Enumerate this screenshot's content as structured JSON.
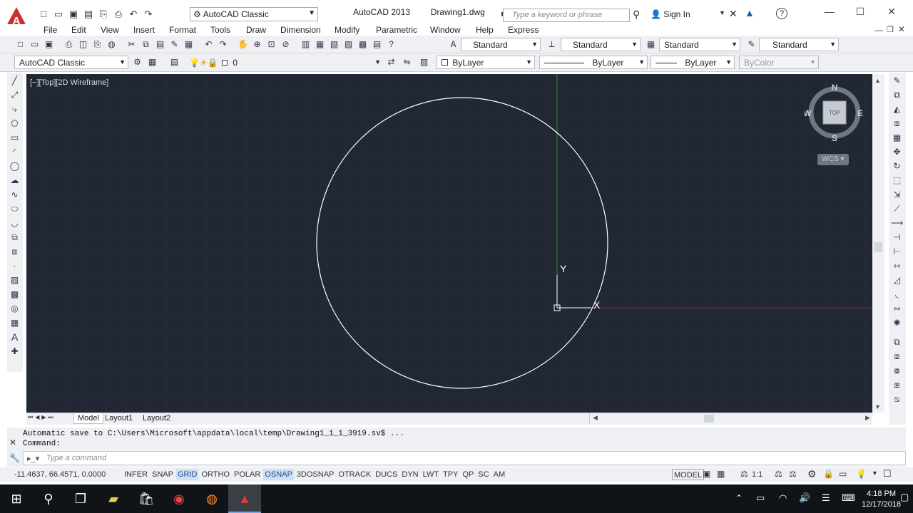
{
  "app": {
    "title": "AutoCAD 2013",
    "document": "Drawing1.dwg",
    "workspace": "AutoCAD Classic",
    "search_placeholder": "Type a keyword or phrase",
    "sign_in": "Sign In",
    "help": "?"
  },
  "menu": [
    "File",
    "Edit",
    "View",
    "Insert",
    "Format",
    "Tools",
    "Draw",
    "Dimension",
    "Modify",
    "Parametric",
    "Window",
    "Help",
    "Express"
  ],
  "toolbar_styles": {
    "text_style": "Standard",
    "dim_style": "Standard",
    "table_style": "Standard",
    "mleader_style": "Standard"
  },
  "toolbar_layers": {
    "workspace": "AutoCAD Classic",
    "layer": "0",
    "color": "ByLayer",
    "linetype": "ByLayer",
    "lineweight": "ByLayer",
    "plotstyle": "ByColor"
  },
  "viewport": {
    "label": "[−][Top][2D Wireframe]",
    "ucs_x": "X",
    "ucs_y": "Y"
  },
  "viewcube": {
    "north": "N",
    "south": "S",
    "east": "E",
    "west": "W",
    "face": "TOP",
    "wcs": "WCS"
  },
  "layout_tabs": [
    "Model",
    "Layout1",
    "Layout2"
  ],
  "command": {
    "history_1": "Automatic save to C:\\Users\\Microsoft\\appdata\\local\\temp\\Drawing1_1_1_3919.sv$ ...",
    "history_2": "Command:",
    "placeholder": "Type a command"
  },
  "status": {
    "coords": "-11.4637, 66.4571, 0.0000",
    "toggles": [
      {
        "label": "INFER",
        "on": false
      },
      {
        "label": "SNAP",
        "on": false
      },
      {
        "label": "GRID",
        "on": true
      },
      {
        "label": "ORTHO",
        "on": false
      },
      {
        "label": "POLAR",
        "on": false
      },
      {
        "label": "OSNAP",
        "on": true
      },
      {
        "label": "3DOSNAP",
        "on": false
      },
      {
        "label": "OTRACK",
        "on": false
      },
      {
        "label": "DUCS",
        "on": false
      },
      {
        "label": "DYN",
        "on": false
      },
      {
        "label": "LWT",
        "on": false
      },
      {
        "label": "TPY",
        "on": false
      },
      {
        "label": "QP",
        "on": false
      },
      {
        "label": "SC",
        "on": false
      },
      {
        "label": "AM",
        "on": false
      }
    ],
    "model": "MODEL",
    "scale": "1:1"
  },
  "taskbar": {
    "time": "4:18 PM",
    "date": "12/17/2018"
  },
  "colors": {
    "canvas": "#212733",
    "circle": "#ffffff",
    "y_axis": "#2e8b3c",
    "x_axis": "#a02828",
    "accent": "#cfe0f5"
  }
}
